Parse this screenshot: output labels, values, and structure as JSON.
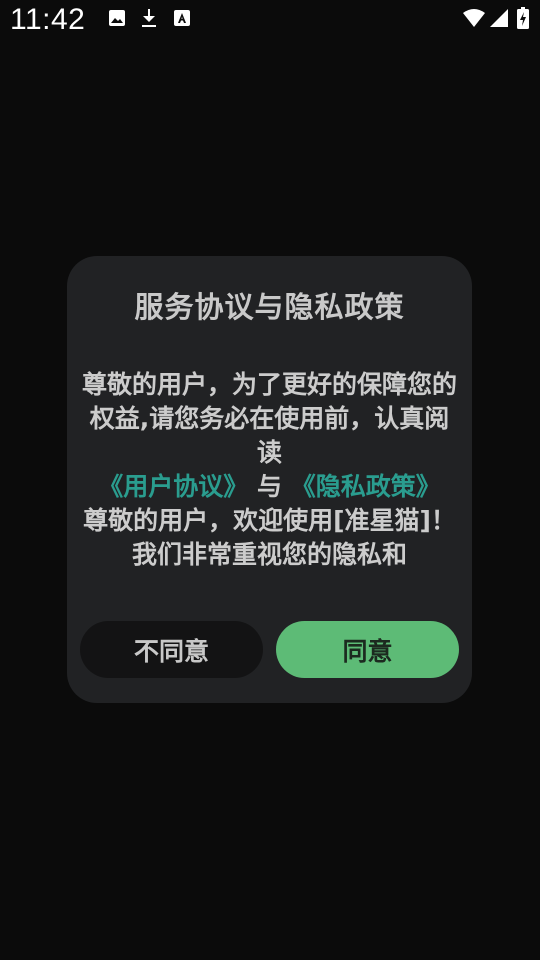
{
  "status_bar": {
    "time": "11:42",
    "left_icons": [
      "image-icon",
      "download-icon",
      "accessibility-a-icon"
    ],
    "right_icons": [
      "wifi-icon",
      "signal-icon",
      "battery-charging-icon"
    ]
  },
  "dialog": {
    "title": "服务协议与隐私政策",
    "body": {
      "intro": "尊敬的用户，为了更好的保障您的权益,请您务必在使用前，认真阅读",
      "user_agreement_link": "《用户协议》",
      "separator": " 与 ",
      "privacy_policy_link": "《隐私政策》",
      "welcome": "尊敬的用户，欢迎使用[准星猫]！我们非常重视您的隐私和"
    },
    "disagree_label": "不同意",
    "agree_label": "同意"
  },
  "colors": {
    "background": "#0b0b0b",
    "dialog_bg": "#212224",
    "link": "#2a9d8f",
    "agree_button": "#5dbb76",
    "disagree_button": "#131314"
  }
}
